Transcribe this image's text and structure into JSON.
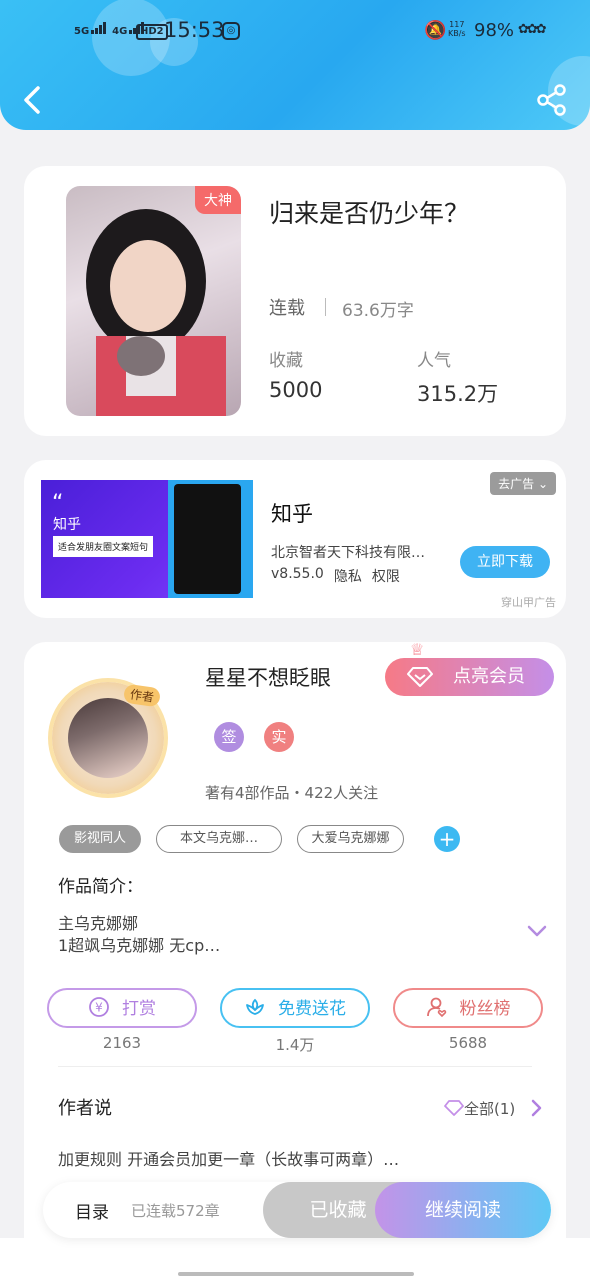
{
  "status_bar": {
    "signal1": "5G",
    "signal2": "4G",
    "hd": "HD2",
    "time": "15:53",
    "speed_value": "117",
    "speed_unit": "KB/s",
    "battery": "98%",
    "icons": [
      "signal-icon",
      "hd-icon",
      "app-icon",
      "mute-bell-icon",
      "flower-icon"
    ]
  },
  "header": {
    "back_icon": "chevron-left-icon",
    "share_icon": "share-icon"
  },
  "book": {
    "badge": "大神",
    "title": "归来是否仍少年？",
    "status": "连载",
    "word_count": "63.6万字",
    "favorites_label": "收藏",
    "favorites_value": "5000",
    "popularity_label": "人气",
    "popularity_value": "315.2万"
  },
  "ad": {
    "image_brand": "知乎",
    "image_slogan": "适合发朋友圈文案短句",
    "close_label": "去广告",
    "app_name": "知乎",
    "company": "北京智者天下科技有限…",
    "version": "v8.55.0",
    "privacy": "隐私",
    "permissions": "权限",
    "download_label": "立即下载",
    "source": "穿山甲广告"
  },
  "author": {
    "avatar_tag": "作者",
    "name": "星星不想眨眼",
    "vip_label": "点亮会员",
    "badge_sign": "签",
    "badge_real": "实",
    "works_summary": "著有4部作品・422人关注",
    "tags": [
      "影视同人",
      "本文乌克娜…",
      "大爱乌克娜娜"
    ],
    "add_tag": "+",
    "intro_title": "作品简介：",
    "intro_line1": "主乌克娜娜",
    "intro_line2": "1超飒乌克娜娜 无cp…",
    "actions": [
      {
        "label": "打赏",
        "count": "2163",
        "icon": "yuan-icon",
        "color": "#b07fe0"
      },
      {
        "label": "免费送花",
        "count": "1.4万",
        "icon": "flower-icon",
        "color": "#2aaee8"
      },
      {
        "label": "粉丝榜",
        "count": "5688",
        "icon": "user-heart-icon",
        "color": "#e07070"
      }
    ],
    "says_title": "作者说",
    "says_all": "全部(1)",
    "says_text": "加更规则 开通会员加更一章（长故事可两章）…"
  },
  "bottom_bar": {
    "toc_label": "目录",
    "chapters": "已连载572章",
    "collected_label": "已收藏",
    "continue_label": "继续阅读"
  }
}
